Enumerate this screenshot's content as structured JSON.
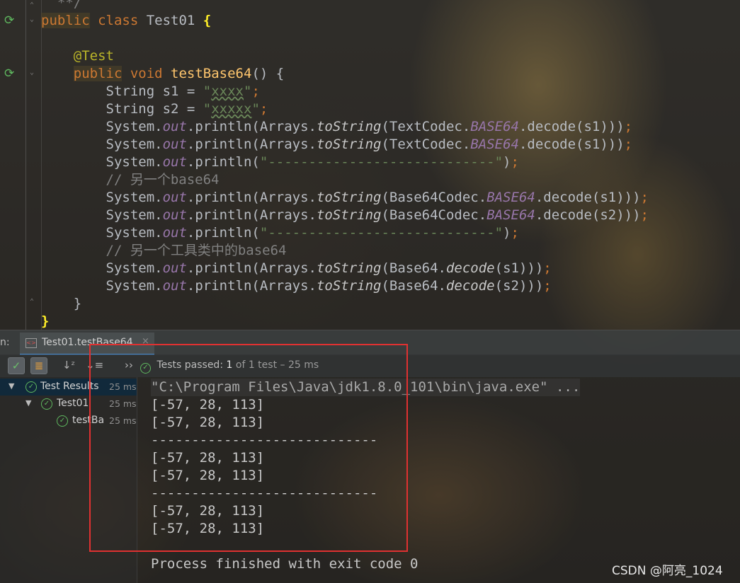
{
  "editor": {
    "lines": [
      {
        "segments": [
          {
            "t": "  **/",
            "c": "cmt"
          }
        ]
      },
      {
        "segments": [
          {
            "t": "public",
            "c": "kwb"
          },
          {
            "t": " class ",
            "c": "kw"
          },
          {
            "t": "Test01 "
          },
          {
            "t": "{",
            "c": "brace-hl"
          }
        ]
      },
      {
        "segments": [
          {
            "t": ""
          }
        ]
      },
      {
        "segments": [
          {
            "t": "    "
          },
          {
            "t": "@Test",
            "c": "ann"
          }
        ]
      },
      {
        "segments": [
          {
            "t": "    "
          },
          {
            "t": "public",
            "c": "kwb"
          },
          {
            "t": " void ",
            "c": "kw"
          },
          {
            "t": "testBase64",
            "c": "fn"
          },
          {
            "t": "() {"
          }
        ]
      },
      {
        "segments": [
          {
            "t": "        String s1 = "
          },
          {
            "t": "\"",
            "c": "str"
          },
          {
            "t": "xxxx",
            "c": "strz"
          },
          {
            "t": "\"",
            "c": "str"
          },
          {
            "t": ";",
            "c": "kw"
          }
        ]
      },
      {
        "segments": [
          {
            "t": "        String s2 = "
          },
          {
            "t": "\"",
            "c": "str"
          },
          {
            "t": "xxxxx",
            "c": "strz"
          },
          {
            "t": "\"",
            "c": "str"
          },
          {
            "t": ";",
            "c": "kw"
          }
        ]
      },
      {
        "segments": [
          {
            "t": "        System."
          },
          {
            "t": "out",
            "c": "field"
          },
          {
            "t": ".println(Arrays."
          },
          {
            "t": "toString",
            "c": "static"
          },
          {
            "t": "(TextCodec."
          },
          {
            "t": "BASE64",
            "c": "field"
          },
          {
            "t": ".decode(s1)))"
          },
          {
            "t": ";",
            "c": "kw"
          }
        ]
      },
      {
        "segments": [
          {
            "t": "        System."
          },
          {
            "t": "out",
            "c": "field"
          },
          {
            "t": ".println(Arrays."
          },
          {
            "t": "toString",
            "c": "static"
          },
          {
            "t": "(TextCodec."
          },
          {
            "t": "BASE64",
            "c": "field"
          },
          {
            "t": ".decode(s1)))"
          },
          {
            "t": ";",
            "c": "kw"
          }
        ]
      },
      {
        "segments": [
          {
            "t": "        System."
          },
          {
            "t": "out",
            "c": "field"
          },
          {
            "t": ".println("
          },
          {
            "t": "\"----------------------------\"",
            "c": "str"
          },
          {
            "t": ")"
          },
          {
            "t": ";",
            "c": "kw"
          }
        ]
      },
      {
        "segments": [
          {
            "t": "        // 另一个base64",
            "c": "cmt"
          }
        ]
      },
      {
        "segments": [
          {
            "t": "        System."
          },
          {
            "t": "out",
            "c": "field"
          },
          {
            "t": ".println(Arrays."
          },
          {
            "t": "toString",
            "c": "static"
          },
          {
            "t": "(Base64Codec."
          },
          {
            "t": "BASE64",
            "c": "field"
          },
          {
            "t": ".decode(s1)))"
          },
          {
            "t": ";",
            "c": "kw"
          }
        ]
      },
      {
        "segments": [
          {
            "t": "        System."
          },
          {
            "t": "out",
            "c": "field"
          },
          {
            "t": ".println(Arrays."
          },
          {
            "t": "toString",
            "c": "static"
          },
          {
            "t": "(Base64Codec."
          },
          {
            "t": "BASE64",
            "c": "field"
          },
          {
            "t": ".decode(s2)))"
          },
          {
            "t": ";",
            "c": "kw"
          }
        ]
      },
      {
        "segments": [
          {
            "t": "        System."
          },
          {
            "t": "out",
            "c": "field"
          },
          {
            "t": ".println("
          },
          {
            "t": "\"----------------------------\"",
            "c": "str"
          },
          {
            "t": ")"
          },
          {
            "t": ";",
            "c": "kw"
          }
        ]
      },
      {
        "segments": [
          {
            "t": "        // 另一个工具类中的base64",
            "c": "cmt"
          }
        ]
      },
      {
        "segments": [
          {
            "t": "        System."
          },
          {
            "t": "out",
            "c": "field"
          },
          {
            "t": ".println(Arrays."
          },
          {
            "t": "toString",
            "c": "static"
          },
          {
            "t": "(Base64."
          },
          {
            "t": "decode",
            "c": "static"
          },
          {
            "t": "(s1)))"
          },
          {
            "t": ";",
            "c": "kw"
          }
        ]
      },
      {
        "segments": [
          {
            "t": "        System."
          },
          {
            "t": "out",
            "c": "field"
          },
          {
            "t": ".println(Arrays."
          },
          {
            "t": "toString",
            "c": "static"
          },
          {
            "t": "(Base64."
          },
          {
            "t": "decode",
            "c": "static"
          },
          {
            "t": "(s2)))"
          },
          {
            "t": ";",
            "c": "kw"
          }
        ]
      },
      {
        "segments": [
          {
            "t": "    }"
          }
        ]
      },
      {
        "segments": [
          {
            "t": "}",
            "c": "brace-hl"
          }
        ]
      }
    ]
  },
  "run_panel": {
    "prefix": "n:",
    "tab_label": "Test01.testBase64",
    "tab_close": "×",
    "status": {
      "label": "Tests passed:",
      "count": "1",
      "rest": "of 1 test",
      "duration": "– 25 ms"
    },
    "tree": [
      {
        "name": "Test Results",
        "time": "25 ms",
        "arrow": "▼"
      },
      {
        "name": "Test01",
        "time": "25 ms",
        "arrow": "▼"
      },
      {
        "name": "testBa",
        "time": "25 ms",
        "arrow": ""
      }
    ],
    "console_lines": [
      "\"C:\\Program Files\\Java\\jdk1.8.0_101\\bin\\java.exe\" ...",
      "[-57, 28, 113]",
      "[-57, 28, 113]",
      "----------------------------",
      "[-57, 28, 113]",
      "[-57, 28, 113]",
      "----------------------------",
      "[-57, 28, 113]",
      "[-57, 28, 113]",
      "",
      "Process finished with exit code 0"
    ]
  },
  "watermark": "CSDN @阿亮_1024",
  "colors": {
    "keyword": "#cc7832",
    "string": "#6a8759",
    "field": "#9876aa",
    "function": "#ffc66d",
    "pass_green": "#5fb85f",
    "highlight_box": "#e03131"
  }
}
